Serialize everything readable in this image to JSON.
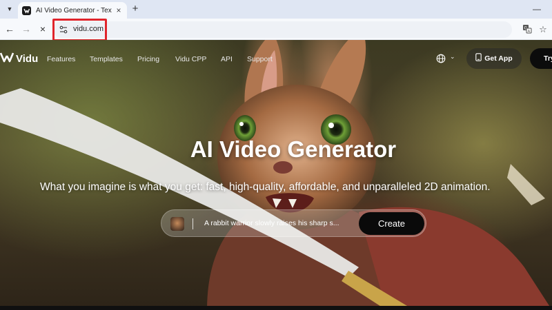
{
  "browser": {
    "tab": {
      "title": "AI Video Generator - Text & Im"
    },
    "new_tab_label": "+",
    "address": {
      "url": "vidu.com"
    }
  },
  "site": {
    "logo_text": "Vidu",
    "nav": [
      "Features",
      "Templates",
      "Pricing",
      "Vidu CPP",
      "API",
      "Support"
    ],
    "get_app_label": "Get App",
    "try_label": "Try"
  },
  "hero": {
    "title": "AI Video Generator",
    "subtitle": "What you imagine is what you get: fast, high-quality, affordable, and unparalleled 2D animation.",
    "prompt_text": "A rabbit warrior slowly raises his sharp s...",
    "create_label": "Create"
  },
  "colors": {
    "highlight": "#e0242b",
    "create_button": "#0a0a0a",
    "tab_strip": "#dfe6f3"
  },
  "icons": [
    "tab-search-icon",
    "vidu-favicon",
    "close-icon",
    "back-arrow-icon",
    "forward-arrow-icon",
    "stop-icon",
    "site-info-icon",
    "translate-icon",
    "star-icon",
    "vidu-logo-icon",
    "globe-icon",
    "chevron-down-icon",
    "phone-icon"
  ]
}
